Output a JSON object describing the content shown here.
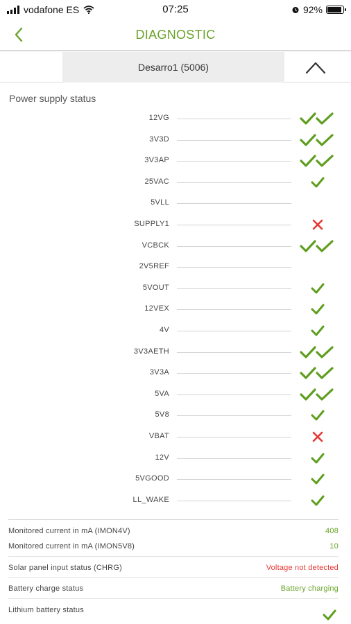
{
  "status_bar": {
    "carrier": "vodafone ES",
    "time": "07:25",
    "battery_percent": "92%"
  },
  "header": {
    "title": "DIAGNOSTIC"
  },
  "device": {
    "name": "Desarro1 (5006)"
  },
  "power_supply": {
    "title": "Power supply status",
    "rows": [
      {
        "label": "12VG",
        "status": "double-check"
      },
      {
        "label": "3V3D",
        "status": "double-check"
      },
      {
        "label": "3V3AP",
        "status": "double-check"
      },
      {
        "label": "25VAC",
        "status": "check"
      },
      {
        "label": "5VLL",
        "status": "none"
      },
      {
        "label": "SUPPLY1",
        "status": "cross"
      },
      {
        "label": "VCBCK",
        "status": "double-check"
      },
      {
        "label": "2V5REF",
        "status": "none"
      },
      {
        "label": "5VOUT",
        "status": "check"
      },
      {
        "label": "12VEX",
        "status": "check"
      },
      {
        "label": "4V",
        "status": "check"
      },
      {
        "label": "3V3AETH",
        "status": "double-check"
      },
      {
        "label": "3V3A",
        "status": "double-check"
      },
      {
        "label": "5VA",
        "status": "double-check"
      },
      {
        "label": "5V8",
        "status": "check"
      },
      {
        "label": "VBAT",
        "status": "cross"
      },
      {
        "label": "12V",
        "status": "check"
      },
      {
        "label": "5VGOOD",
        "status": "check"
      },
      {
        "label": "LL_WAKE",
        "status": "check"
      }
    ]
  },
  "info": {
    "imon4v_label": "Monitored current in mA (IMON4V)",
    "imon4v_value": "408",
    "imon5v8_label": "Monitored current in mA (IMON5V8)",
    "imon5v8_value": "10",
    "solar_label": "Solar panel input status (CHRG)",
    "solar_value": "Voltage not detected",
    "charge_label": "Battery charge status",
    "charge_value": "Battery charging",
    "lithium_label": "Lithium battery status",
    "lithium_status": "check"
  },
  "colors": {
    "accent_green": "#6aa32b",
    "check_green": "#5e9e1e",
    "error_red": "#e53935"
  },
  "icons": {
    "back": "chevron-left-icon",
    "collapse": "chevron-up-icon",
    "ok": "check-icon",
    "double_ok": "double-check-icon",
    "error": "cross-icon"
  }
}
